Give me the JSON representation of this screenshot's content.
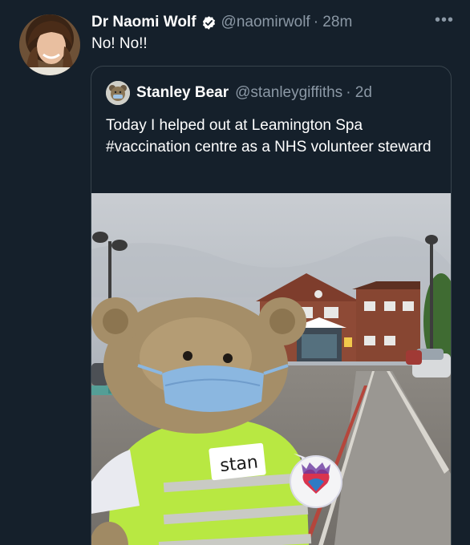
{
  "tweet": {
    "author_name": "Dr Naomi Wolf",
    "author_handle": "@naomirwolf",
    "timestamp": "· 28m",
    "text": "No! No!!",
    "more_label": "•••",
    "verified_icon": "verified-badge-icon"
  },
  "quoted_tweet": {
    "author_name": "Stanley Bear",
    "author_handle": "@stanleygiffiths",
    "timestamp": "· 2d",
    "text": "Today I helped out at Leamington Spa #vaccination centre as a NHS volunteer steward",
    "photo": {
      "vest_label": "stan"
    }
  },
  "colors": {
    "background": "#15202b",
    "text_primary": "#ffffff",
    "text_secondary": "#8b98a5",
    "border": "#38444d",
    "verified": "#ffffff"
  }
}
